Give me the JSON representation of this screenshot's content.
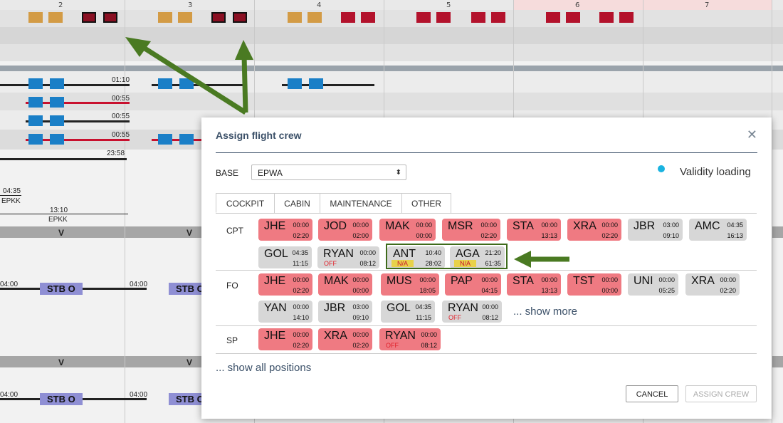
{
  "gantt": {
    "days": [
      "2",
      "3",
      "4",
      "5",
      "6",
      "7"
    ],
    "times": [
      "01:10",
      "00:55",
      "00:55",
      "00:55",
      "23:58",
      "04:35",
      "13:10",
      "04:00",
      "04:00",
      "04:00",
      "04:00"
    ],
    "airports": [
      "EPKK",
      "EPKK"
    ],
    "v_label": "V",
    "stb_label": "STB O"
  },
  "dialog": {
    "title": "Assign flight crew",
    "base_label": "BASE",
    "base_value": "EPWA",
    "validity": "Validity loading",
    "tabs": [
      "COCKPIT",
      "CABIN",
      "MAINTENANCE",
      "OTHER"
    ],
    "positions": [
      {
        "label": "CPT",
        "crew": [
          {
            "code": "JHE",
            "t1": "00:00",
            "t2": "02:20",
            "status": "",
            "color": "pink"
          },
          {
            "code": "JOD",
            "t1": "00:00",
            "t2": "02:00",
            "status": "",
            "color": "pink"
          },
          {
            "code": "MAK",
            "t1": "00:00",
            "t2": "00:00",
            "status": "",
            "color": "pink"
          },
          {
            "code": "MSR",
            "t1": "00:00",
            "t2": "02:20",
            "status": "",
            "color": "pink"
          },
          {
            "code": "STA",
            "t1": "00:00",
            "t2": "13:13",
            "status": "",
            "color": "pink"
          },
          {
            "code": "XRA",
            "t1": "00:00",
            "t2": "02:20",
            "status": "",
            "color": "pink"
          },
          {
            "code": "JBR",
            "t1": "03:00",
            "t2": "09:10",
            "status": "",
            "color": "grey"
          },
          {
            "code": "AMC",
            "t1": "04:35",
            "t2": "16:13",
            "status": "",
            "color": "grey"
          },
          {
            "code": "GOL",
            "t1": "04:35",
            "t2": "11:15",
            "status": "",
            "color": "grey"
          },
          {
            "code": "RYAN",
            "t1": "00:00",
            "t2": "08:12",
            "status": "OFF",
            "color": "grey"
          },
          {
            "code": "ANT",
            "t1": "10:40",
            "t2": "28:02",
            "status": "N/A",
            "color": "grey"
          },
          {
            "code": "AGA",
            "t1": "21:20",
            "t2": "61:35",
            "status": "N/A",
            "color": "grey"
          }
        ]
      },
      {
        "label": "FO",
        "crew": [
          {
            "code": "JHE",
            "t1": "00:00",
            "t2": "02:20",
            "status": "",
            "color": "pink"
          },
          {
            "code": "MAK",
            "t1": "00:00",
            "t2": "00:00",
            "status": "",
            "color": "pink"
          },
          {
            "code": "MUS",
            "t1": "00:00",
            "t2": "18:05",
            "status": "",
            "color": "pink"
          },
          {
            "code": "PAP",
            "t1": "00:00",
            "t2": "04:15",
            "status": "",
            "color": "pink"
          },
          {
            "code": "STA",
            "t1": "00:00",
            "t2": "13:13",
            "status": "",
            "color": "pink"
          },
          {
            "code": "TST",
            "t1": "00:00",
            "t2": "00:00",
            "status": "",
            "color": "pink"
          },
          {
            "code": "UNI",
            "t1": "00:00",
            "t2": "05:25",
            "status": "",
            "color": "grey"
          },
          {
            "code": "XRA",
            "t1": "00:00",
            "t2": "02:20",
            "status": "",
            "color": "grey"
          },
          {
            "code": "YAN",
            "t1": "00:00",
            "t2": "14:10",
            "status": "",
            "color": "grey"
          },
          {
            "code": "JBR",
            "t1": "03:00",
            "t2": "09:10",
            "status": "",
            "color": "grey"
          },
          {
            "code": "GOL",
            "t1": "04:35",
            "t2": "11:15",
            "status": "",
            "color": "grey"
          },
          {
            "code": "RYAN",
            "t1": "00:00",
            "t2": "08:12",
            "status": "OFF",
            "color": "grey"
          }
        ],
        "show_more": "... show more"
      },
      {
        "label": "SP",
        "crew": [
          {
            "code": "JHE",
            "t1": "00:00",
            "t2": "02:20",
            "status": "",
            "color": "pink"
          },
          {
            "code": "XRA",
            "t1": "00:00",
            "t2": "02:20",
            "status": "",
            "color": "pink"
          },
          {
            "code": "RYAN",
            "t1": "00:00",
            "t2": "08:12",
            "status": "OFF",
            "color": "pink"
          }
        ]
      }
    ],
    "show_all": "... show all positions",
    "cancel": "CANCEL",
    "assign": "ASSIGN CREW"
  },
  "colors": {
    "pink": "#ef7a82",
    "grey": "#d7d7d7",
    "accent": "#3b5068",
    "arrow": "#4a7a22"
  }
}
